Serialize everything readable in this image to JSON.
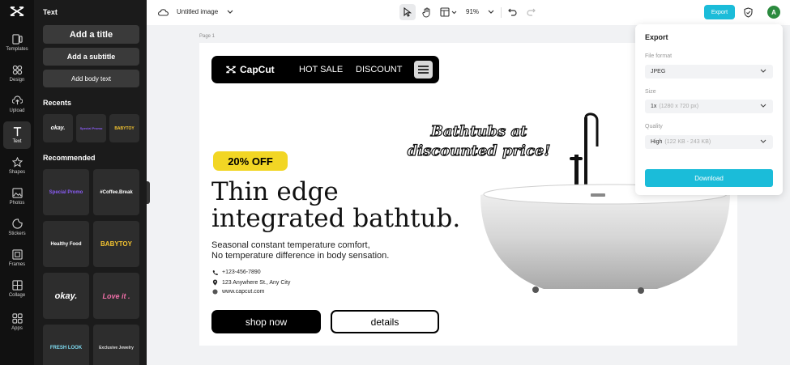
{
  "rail": {
    "items": [
      {
        "label": "Templates",
        "icon": "templates-icon"
      },
      {
        "label": "Design",
        "icon": "design-icon"
      },
      {
        "label": "Upload",
        "icon": "upload-icon"
      },
      {
        "label": "Text",
        "icon": "text-icon"
      },
      {
        "label": "Shapes",
        "icon": "shapes-icon"
      },
      {
        "label": "Photos",
        "icon": "photos-icon"
      },
      {
        "label": "Stickers",
        "icon": "stickers-icon"
      },
      {
        "label": "Frames",
        "icon": "frames-icon"
      },
      {
        "label": "Collage",
        "icon": "collage-icon"
      },
      {
        "label": "Apps",
        "icon": "apps-icon"
      }
    ],
    "active": "Text"
  },
  "text_panel": {
    "title": "Text",
    "add_title": "Add a title",
    "add_subtitle": "Add a subtitle",
    "add_body": "Add body text",
    "recents_heading": "Recents",
    "recents": [
      "okay.",
      "Special Promo",
      "BABYTOY"
    ],
    "recommended_heading": "Recommended",
    "recommended": [
      "Special Promo",
      "#Coffee.Break",
      "Healthy Food",
      "BABYTOY",
      "okay.",
      "Love it .",
      "FRESH LOOK",
      "Exclusive Jewelry"
    ]
  },
  "topbar": {
    "doc_title": "Untitled image",
    "zoom": "91%",
    "export_label": "Export",
    "avatar_initial": "A"
  },
  "canvas": {
    "page_label": "Page 1",
    "brand": "CapCut",
    "nav_items": [
      "HOT SALE",
      "DISCOUNT"
    ],
    "badge": "20% OFF",
    "headline_line1": "Thin edge",
    "headline_line2": "integrated bathtub.",
    "sub_line1": "Seasonal constant temperature comfort,",
    "sub_line2": "No temperature difference in body sensation.",
    "phone": "+123-456-7890",
    "address": "123 Anywhere St., Any City",
    "website": "www.capcut.com",
    "shop_button": "shop now",
    "details_button": "details",
    "deco_line1": "Bathtubs at",
    "deco_line2": "discounted price!"
  },
  "export_panel": {
    "title": "Export",
    "file_format_label": "File format",
    "file_format_value": "JPEG",
    "size_label": "Size",
    "size_value": "1x",
    "size_hint": "(1280 x 720 px)",
    "quality_label": "Quality",
    "quality_value": "High",
    "quality_hint": "(122 KB - 243 KB)",
    "download_label": "Download"
  },
  "colors": {
    "accent": "#1bbcd9",
    "badge_yellow": "#f2d624",
    "avatar_green": "#2b8a3e"
  }
}
